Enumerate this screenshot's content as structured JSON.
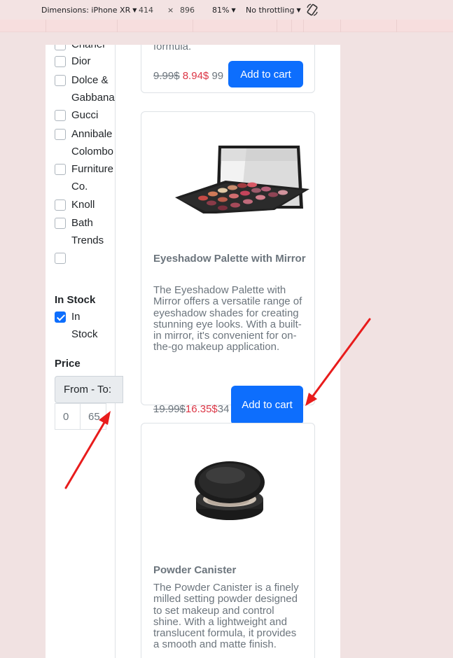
{
  "devtools": {
    "dimensions_label": "Dimensions: iPhone XR",
    "width": "414",
    "times": "×",
    "height": "896",
    "zoom": "81%",
    "throttling": "No throttling"
  },
  "filters": {
    "brands": [
      "Chanel",
      "Dior",
      "Dolce & Gabbana",
      "Gucci",
      "Annibale Colombo",
      "Furniture Co.",
      "Knoll",
      "Bath Trends",
      ""
    ],
    "in_stock_title": "In Stock",
    "in_stock_option": "In Stock",
    "price_title": "Price",
    "price_range_label": "From - To:",
    "price_from": "0",
    "price_to": "65"
  },
  "products": [
    {
      "desc_tail": "formula.",
      "old_price": "9.99$",
      "new_price": "8.94$",
      "extra": "99",
      "button": "Add to cart"
    },
    {
      "title": "Eyeshadow Palette with Mirror",
      "description": "The Eyeshadow Palette with Mirror offers a versatile range of eyeshadow shades for creating stunning eye looks. With a built-in mirror, it's convenient for on-the-go makeup application.",
      "old_price": "19.99$",
      "new_price": "16.35$",
      "extra": "34",
      "button": "Add to cart"
    },
    {
      "title": "Powder Canister",
      "description": "The Powder Canister is a finely milled setting powder designed to set makeup and control shine. With a lightweight and translucent formula, it provides a smooth and matte finish."
    }
  ],
  "colors": {
    "page_bg": "#f1e2e2",
    "primary": "#0d6efd",
    "sale": "#dc3545",
    "muted": "#6c757d",
    "annotation": "#e81c1c"
  }
}
